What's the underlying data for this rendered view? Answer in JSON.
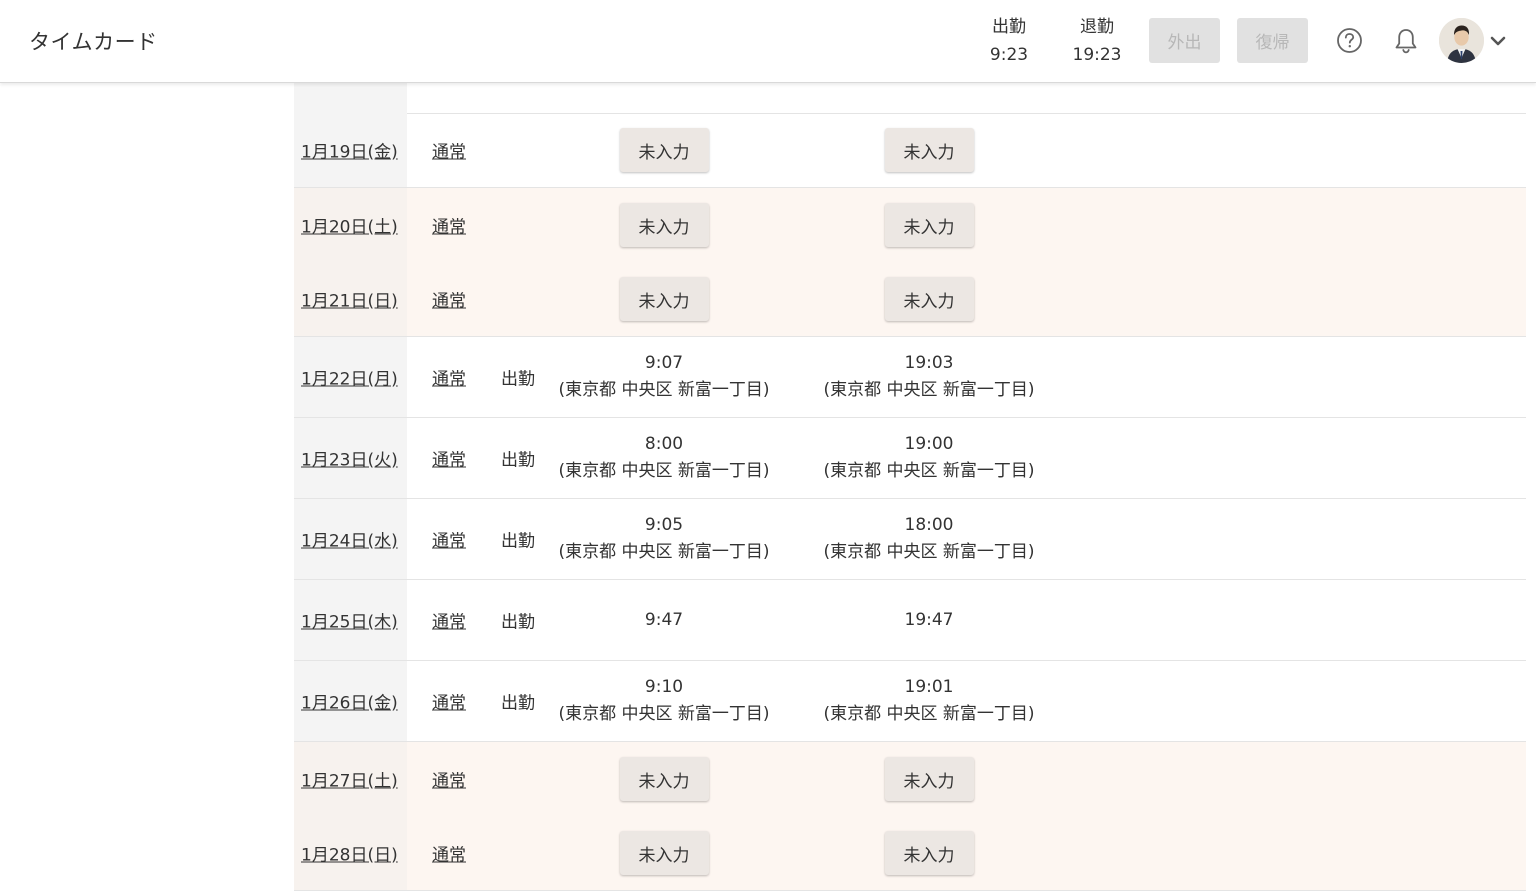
{
  "header": {
    "title": "タイムカード",
    "clock_in": {
      "label": "出勤",
      "time": "9:23"
    },
    "clock_out": {
      "label": "退勤",
      "time": "19:23"
    },
    "go_out_button": "外出",
    "return_button": "復帰"
  },
  "rows": [
    {
      "date": "1月19日(金)",
      "kind": "通常",
      "status": "",
      "weekend": false,
      "in": {
        "button": "未入力"
      },
      "out": {
        "button": "未入力"
      }
    },
    {
      "date": "1月20日(土)",
      "kind": "通常",
      "status": "",
      "weekend": true,
      "in": {
        "button": "未入力"
      },
      "out": {
        "button": "未入力"
      }
    },
    {
      "date": "1月21日(日)",
      "kind": "通常",
      "status": "",
      "weekend": true,
      "in": {
        "button": "未入力"
      },
      "out": {
        "button": "未入力"
      }
    },
    {
      "date": "1月22日(月)",
      "kind": "通常",
      "status": "出勤",
      "weekend": false,
      "in": {
        "time": "9:07",
        "location": "(東京都 中央区 新富一丁目)"
      },
      "out": {
        "time": "19:03",
        "location": "(東京都 中央区 新富一丁目)"
      }
    },
    {
      "date": "1月23日(火)",
      "kind": "通常",
      "status": "出勤",
      "weekend": false,
      "in": {
        "time": "8:00",
        "location": "(東京都 中央区 新富一丁目)"
      },
      "out": {
        "time": "19:00",
        "location": "(東京都 中央区 新富一丁目)"
      }
    },
    {
      "date": "1月24日(水)",
      "kind": "通常",
      "status": "出勤",
      "weekend": false,
      "in": {
        "time": "9:05",
        "location": "(東京都 中央区 新富一丁目)"
      },
      "out": {
        "time": "18:00",
        "location": "(東京都 中央区 新富一丁目)"
      }
    },
    {
      "date": "1月25日(木)",
      "kind": "通常",
      "status": "出勤",
      "weekend": false,
      "in": {
        "time": "9:47"
      },
      "out": {
        "time": "19:47"
      }
    },
    {
      "date": "1月26日(金)",
      "kind": "通常",
      "status": "出勤",
      "weekend": false,
      "in": {
        "time": "9:10",
        "location": "(東京都 中央区 新富一丁目)"
      },
      "out": {
        "time": "19:01",
        "location": "(東京都 中央区 新富一丁目)"
      }
    },
    {
      "date": "1月27日(土)",
      "kind": "通常",
      "status": "",
      "weekend": true,
      "in": {
        "button": "未入力"
      },
      "out": {
        "button": "未入力"
      }
    },
    {
      "date": "1月28日(日)",
      "kind": "通常",
      "status": "",
      "weekend": true,
      "in": {
        "button": "未入力"
      },
      "out": {
        "button": "未入力"
      }
    }
  ],
  "icons": {
    "help": "help-circle-icon",
    "notifications": "bell-icon",
    "menu": "chevron-down-icon"
  },
  "colors": {
    "weekend_row": "#fdf6f1",
    "date_column": "#f4f4f4",
    "disabled_button": "#e1e1e1"
  }
}
